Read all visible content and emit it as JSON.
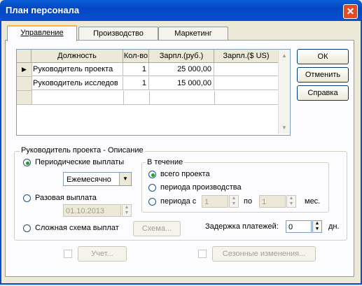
{
  "window": {
    "title": "План персонала",
    "close": "✕"
  },
  "tabs": [
    "Управление",
    "Производство",
    "Маркетинг"
  ],
  "grid": {
    "columns": [
      "Должность",
      "Кол-во",
      "Зарпл.(руб.)",
      "Зарпл.($ US)"
    ],
    "rows": [
      {
        "title": "Руководитель проекта",
        "count": "1",
        "rub": "25 000,00",
        "usd": ""
      },
      {
        "title": "Руководитель исследов",
        "count": "1",
        "rub": "15 000,00",
        "usd": ""
      }
    ],
    "row_marker": "▶"
  },
  "buttons": {
    "ok": "ОК",
    "cancel": "Отменить",
    "help": "Справка"
  },
  "description": {
    "legend": "Руководитель проекта - Описание",
    "periodic_label": "Периодические выплаты",
    "frequency_value": "Ежемесячно",
    "single_label": "Разовая выплата",
    "single_date": "01.10.2013",
    "complex_label": "Сложная схема выплат",
    "scheme_button": "Схема...",
    "selected_payment": "periodic"
  },
  "during": {
    "legend": "В течение",
    "whole_project": "всего проекта",
    "production_period": "периода производства",
    "period_from": "периода с",
    "from_value": "1",
    "to_label": "по",
    "to_value": "1",
    "months": "мес.",
    "selected": "whole_project"
  },
  "delay": {
    "label": "Задержка платежей:",
    "value": "0",
    "unit": "дн."
  },
  "bottom": {
    "accounting": "Учет...",
    "seasonal": "Сезонные изменения..."
  },
  "icons": {
    "dropdown": "▼",
    "spin_up": "▲",
    "spin_down": "▼",
    "scroll_up": "▲",
    "scroll_down": "▼"
  }
}
